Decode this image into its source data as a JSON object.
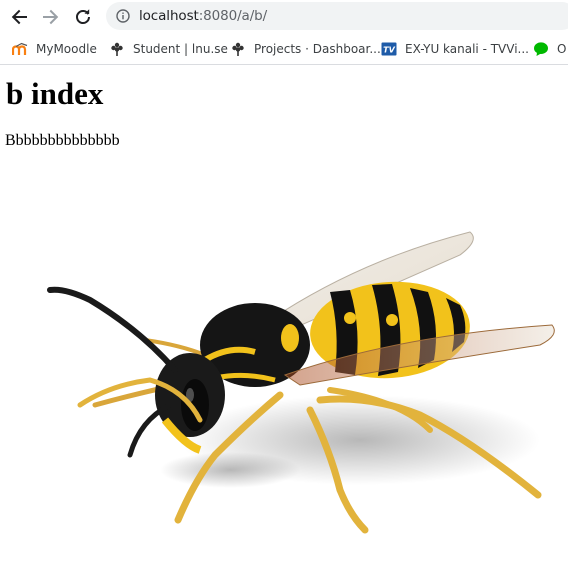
{
  "browser": {
    "nav": {
      "back_icon": "arrow-left-icon",
      "forward_icon": "arrow-right-icon",
      "reload_icon": "reload-icon"
    },
    "address_bar": {
      "icon": "info-icon",
      "host": "localhost",
      "rest": ":8080/a/b/"
    },
    "bookmarks": [
      {
        "label": "MyMoodle",
        "icon": "moodle-icon"
      },
      {
        "label": "Student | lnu.se",
        "icon": "tree-icon"
      },
      {
        "label": "Projects · Dashboar...",
        "icon": "tree-icon"
      },
      {
        "label": "EX-YU kanali - TVVi...",
        "icon": "tv-icon"
      },
      {
        "label": "O",
        "icon": "chat-bubble-icon"
      }
    ]
  },
  "page": {
    "heading": "b index",
    "text": "Bbbbbbbbbbbbbb",
    "image_subject": "wasp"
  },
  "colors": {
    "omnibox_bg": "#f1f3f4",
    "moodle_orange": "#f98012",
    "tv_blue": "#1e5ba8",
    "chat_green": "#00b900",
    "wasp_yellow": "#f2c21b"
  }
}
